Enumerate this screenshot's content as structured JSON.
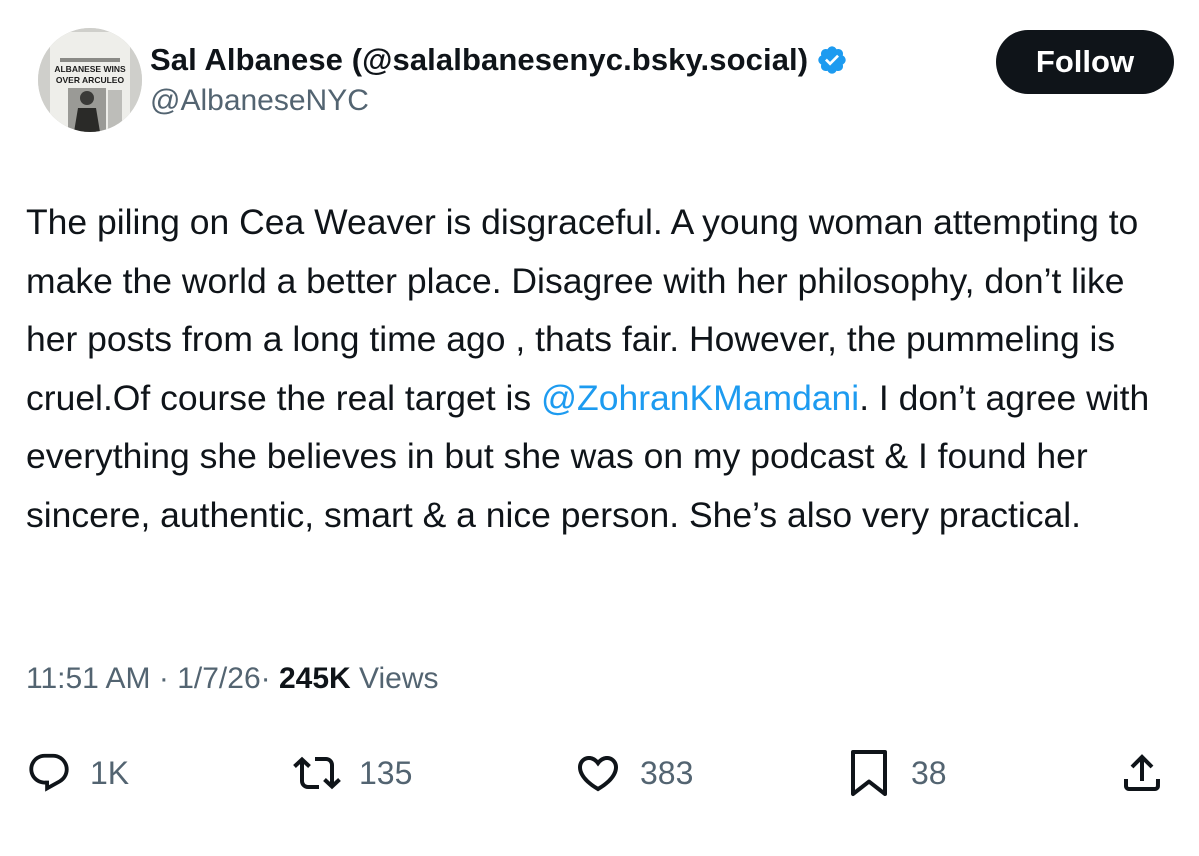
{
  "author": {
    "display_name": "Sal Albanese (@salalbanesenyc.bsky.social)",
    "handle": "@AlbaneseNYC",
    "verified": true,
    "verified_color": "#1d9bf0",
    "avatar": {
      "headline_line1": "ALBANESE WINS",
      "headline_line2": "OVER ARCULEO"
    }
  },
  "follow_label": "Follow",
  "tweet": {
    "text_before_mention": "The piling on Cea Weaver is disgraceful. A young woman attempting to make the world a better place. Disagree with her philosophy,  don’t like her posts from a long time ago , thats fair. However, the pummeling is cruel.Of course the real target is ",
    "mention": "@ZohranKMamdani",
    "text_after_mention": ". I don’t agree with everything she believes in but  she was on my podcast & I found her sincere, authentic, smart & a nice person. She’s also very practical.",
    "mention_color": "#1d9bf0"
  },
  "meta": {
    "time": "11:51 AM",
    "separator": "·",
    "date": "1/7/26",
    "views_count": "245K",
    "views_label": "Views"
  },
  "actions": {
    "replies": "1K",
    "reposts": "135",
    "likes": "383",
    "bookmarks": "38"
  },
  "icons": {
    "reply": "reply-icon",
    "repost": "repost-icon",
    "like": "heart-icon",
    "bookmark": "bookmark-icon",
    "share": "share-icon",
    "verified": "verified-badge-icon"
  }
}
